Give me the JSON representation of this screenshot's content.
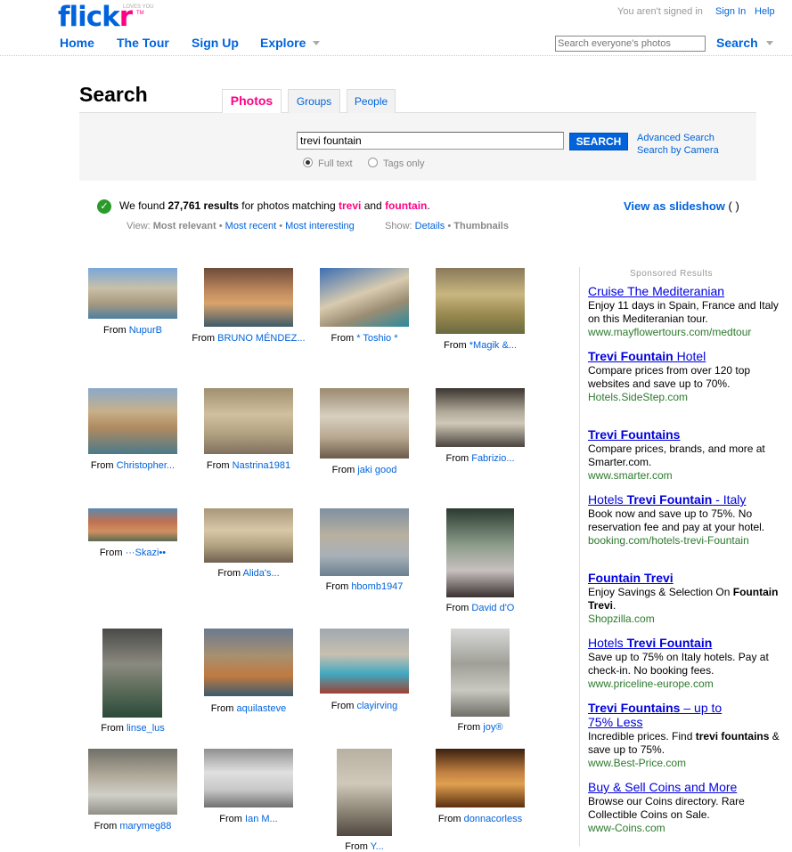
{
  "header": {
    "logo_flick": "flick",
    "logo_r": "r",
    "logo_loves": "LOVES YOU",
    "logo_tm": "TM",
    "signed_out": "You aren't signed in",
    "sign_in": "Sign In",
    "help": "Help",
    "nav": [
      "Home",
      "The Tour",
      "Sign Up",
      "Explore"
    ],
    "search_placeholder": "Search everyone's photos",
    "search_label": "Search"
  },
  "search": {
    "title": "Search",
    "tabs": [
      "Photos",
      "Groups",
      "People"
    ],
    "query": "trevi fountain",
    "button": "SEARCH",
    "advanced": "Advanced Search",
    "by_camera": "Search by Camera",
    "radio_full": "Full text",
    "radio_tags": "Tags only"
  },
  "results": {
    "found_prefix": "We found",
    "count": "27,761 results",
    "found_mid": "for photos matching",
    "term1": "trevi",
    "and": "and",
    "term2": "fountain",
    "period": ".",
    "slideshow": "View as slideshow",
    "slideshow_suffix": "( )",
    "view_label": "View:",
    "view_options": [
      "Most relevant",
      "Most recent",
      "Most interesting"
    ],
    "show_label": "Show:",
    "show_options": [
      "Details",
      "Thumbnails"
    ],
    "bullet": "•"
  },
  "photos": [
    {
      "from": "From",
      "user": "NupurB"
    },
    {
      "from": "From",
      "user": "BRUNO MÉNDEZ..."
    },
    {
      "from": "From",
      "user": "* Toshio *"
    },
    {
      "from": "From",
      "user": "*Magik &..."
    },
    {
      "from": "From",
      "user": "Christopher..."
    },
    {
      "from": "From",
      "user": "Nastrina1981"
    },
    {
      "from": "From",
      "user": "jaki good"
    },
    {
      "from": "From",
      "user": "Fabrizio..."
    },
    {
      "from": "From",
      "user": "···Skazi••"
    },
    {
      "from": "From",
      "user": "Alida's..."
    },
    {
      "from": "From",
      "user": "hbomb1947"
    },
    {
      "from": "From",
      "user": "David d'O"
    },
    {
      "from": "From",
      "user": "linse_lus"
    },
    {
      "from": "From",
      "user": "aquilasteve"
    },
    {
      "from": "From",
      "user": "clayirving"
    },
    {
      "from": "From",
      "user": "joy®"
    },
    {
      "from": "From",
      "user": "marymeg88"
    },
    {
      "from": "From",
      "user": "Ian M..."
    },
    {
      "from": "From",
      "user": "Y..."
    },
    {
      "from": "From",
      "user": "donnacorless"
    }
  ],
  "sponsored": {
    "heading": "Sponsored Results",
    "ads": [
      {
        "title_pre": "Cruise The Mediteranian",
        "title_bold": "",
        "title_post": "",
        "body": "Enjoy 11 days in Spain, France and Italy on this Mediteranian tour.",
        "url": "www.mayflowertours.com/medtour"
      },
      {
        "title_pre": "",
        "title_bold": "Trevi Fountain",
        "title_post": " Hotel",
        "body": "Compare prices from over 120 top websites and save up to 70%.",
        "url": "Hotels.SideStep.com"
      },
      {
        "title_pre": "",
        "title_bold": "Trevi Fountains",
        "title_post": "",
        "body": "Compare prices, brands, and more at Smarter.com.",
        "url": "www.smarter.com"
      },
      {
        "title_pre": "Hotels ",
        "title_bold": "Trevi Fountain",
        "title_post": " - Italy",
        "body": "Book now and save up to 75%. No reservation fee and pay at your hotel.",
        "url": "booking.com/hotels-trevi-Fountain"
      },
      {
        "title_pre": "",
        "title_bold": "Fountain Trevi",
        "title_post": "",
        "body_pre": "Enjoy Savings & Selection On ",
        "body_bold": "Fountain Trevi",
        "body_post": ".",
        "url": "Shopzilla.com"
      },
      {
        "title_pre": "Hotels ",
        "title_bold": "Trevi Fountain",
        "title_post": "",
        "body": "Save up to 75% on Italy hotels. Pay at check-in. No booking fees.",
        "url": "www.priceline-europe.com"
      },
      {
        "title_pre": "",
        "title_bold": "Trevi Fountains",
        "title_post": " – up to 75% Less",
        "body_pre": "Incredible prices. Find ",
        "body_bold": "trevi fountains",
        "body_post": " & save up to 75%.",
        "url": "www.Best-Price.com"
      },
      {
        "title_pre": "Buy & Sell Coins and More",
        "title_bold": "",
        "title_post": "",
        "body": "Browse our Coins directory. Rare Collectible Coins on Sale.",
        "url": "www-Coins.com"
      }
    ]
  }
}
